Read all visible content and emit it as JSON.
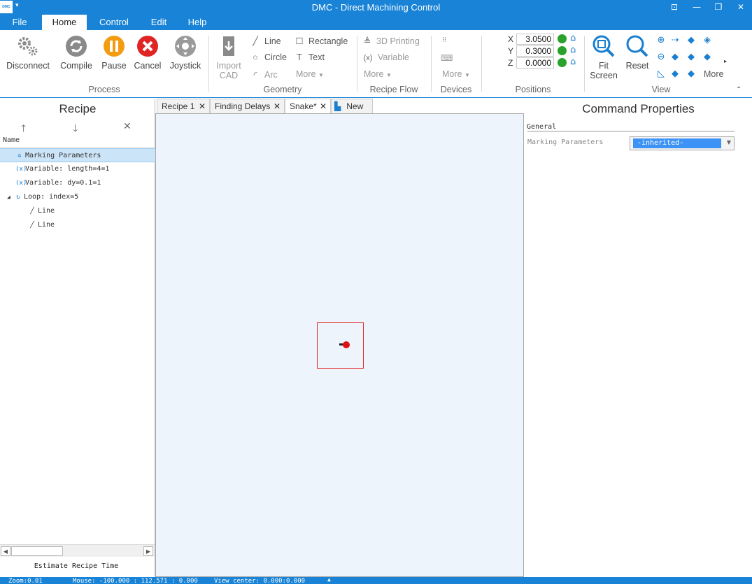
{
  "window": {
    "title": "DMC - Direct Machining Control",
    "logo": "DMC"
  },
  "menu": {
    "tabs": [
      "File",
      "Home",
      "Control",
      "Edit",
      "Help"
    ],
    "active": "Home"
  },
  "ribbon": {
    "process": {
      "label": "Process",
      "items": [
        "Disconnect",
        "Compile",
        "Pause",
        "Cancel",
        "Joystick"
      ]
    },
    "geometry": {
      "label": "Geometry",
      "import_label_1": "Import",
      "import_label_2": "CAD",
      "items": [
        "Line",
        "Circle",
        "Arc",
        "Rectangle",
        "Text",
        "More"
      ]
    },
    "recipe_flow": {
      "label": "Recipe Flow",
      "items": [
        "3D Printing",
        "Variable",
        "More"
      ]
    },
    "devices": {
      "label": "Devices",
      "items": [
        "More"
      ]
    },
    "positions": {
      "label": "Positions",
      "x_label": "X",
      "y_label": "Y",
      "z_label": "Z",
      "x_value": "3.0500",
      "y_value": "0.3000",
      "z_value": "0.0000"
    },
    "view": {
      "label": "View",
      "fit_1": "Fit",
      "fit_2": "Screen",
      "reset": "Reset",
      "more": "More"
    }
  },
  "recipe_panel": {
    "title": "Recipe",
    "column": "Name",
    "rows": [
      {
        "label": "Marking Parameters",
        "icon": "gear-icon"
      },
      {
        "label": "Variable: length=4=1",
        "icon": "variable-icon"
      },
      {
        "label": "Variable: dy=0.1=1",
        "icon": "variable-icon"
      },
      {
        "label": "Loop: index=5",
        "icon": "loop-icon"
      },
      {
        "label": "Line",
        "icon": "line-icon"
      },
      {
        "label": "Line",
        "icon": "line-icon"
      }
    ],
    "estimate": "Estimate Recipe Time"
  },
  "doc_tabs": [
    "Recipe 1",
    "Finding Delays",
    "Snake*",
    "New"
  ],
  "properties": {
    "title": "Command Properties",
    "group": "General",
    "field_label": "Marking Parameters",
    "field_value": "-inherited-"
  },
  "status": {
    "zoom": "Zoom:0.01",
    "mouse": "Mouse: -100.000 : 112.571 : 0.000",
    "view_center": "View center: 0.000:0.000"
  },
  "colors": {
    "accent": "#1883d7",
    "canvas": "#eef4fb",
    "status_ok": "#2aa12a",
    "pause": "#f39c12",
    "cancel": "#e02424"
  }
}
